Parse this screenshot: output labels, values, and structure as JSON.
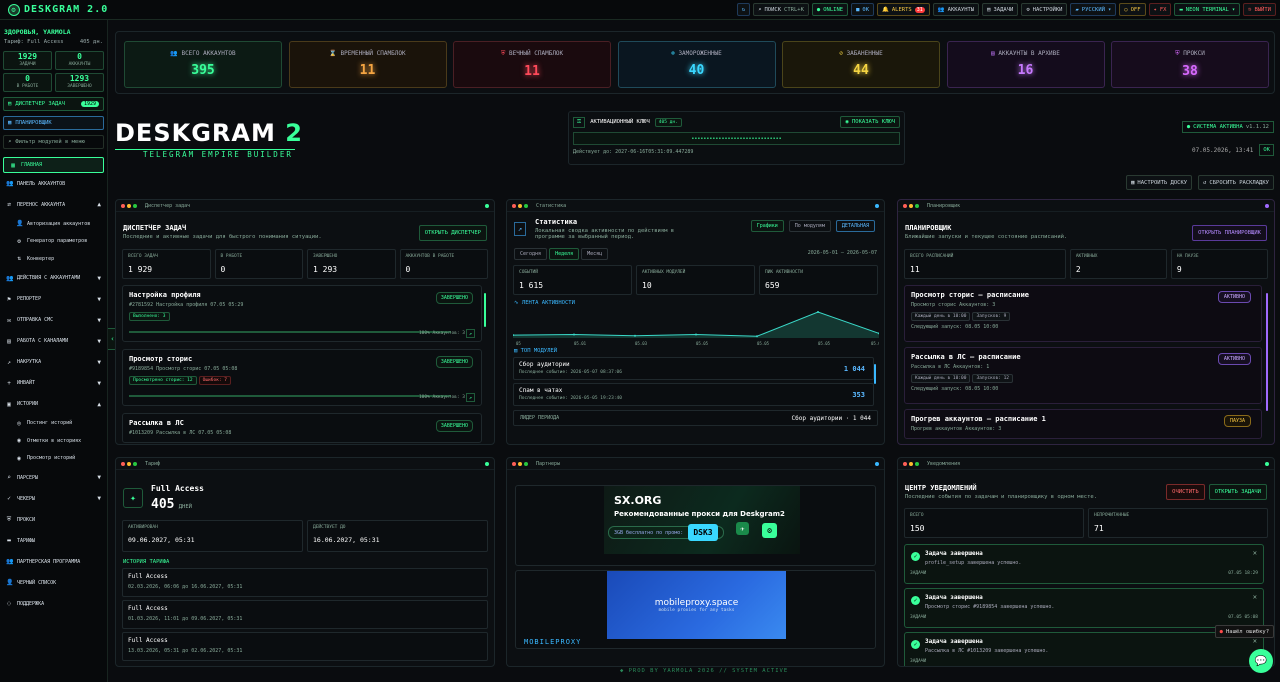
{
  "brand": {
    "name": "DESKGRAM 2.0",
    "logo_glyph": "⚙"
  },
  "topbar": {
    "refresh_icon": "↻",
    "search_label": "ПОИСК",
    "search_hint": "CTRL+K",
    "online": "ONLINE",
    "bell": "0K",
    "alerts_label": "ALERTS",
    "alerts_count": "31",
    "accounts": "АККАУНТЫ",
    "tasks": "ЗАДАЧИ",
    "settings": "НАСТРОЙКИ",
    "lang": "РУССКИЙ",
    "off": "OFF",
    "fx": "FX",
    "terminal": "NEON TERMINAL",
    "logout": "ВЫЙТИ"
  },
  "sidebar": {
    "greeting": "ЗДОРОВЬЯ, YARMOLA",
    "tariff_label": "Тариф: Full Access",
    "tariff_days": "405 дн.",
    "stats": [
      {
        "value": "1929",
        "label": "ЗАДАЧИ"
      },
      {
        "value": "0",
        "label": "АККАУНТЫ"
      },
      {
        "value": "0",
        "label": "В РАБОТЕ"
      },
      {
        "value": "1293",
        "label": "ЗАВЕРШЕНО"
      }
    ],
    "dispatcher_btn": "ДИСПЕТЧЕР ЗАДАЧ",
    "dispatcher_pill": "1929",
    "scheduler_btn": "ПЛАНИРОВЩИК",
    "filter_placeholder": "Фильтр модулей в меню",
    "nav": [
      {
        "label": "ГЛАВНАЯ",
        "icon": "▦",
        "active": true
      },
      {
        "label": "ПАНЕЛЬ АККАУНТОВ",
        "icon": "👥"
      },
      {
        "label": "ПЕРЕНОС АККАУНТА",
        "icon": "⇄",
        "caret": "▲"
      },
      {
        "label": "Авторизация аккаунтов",
        "icon": "👤",
        "sub": true
      },
      {
        "label": "Генератор параметров",
        "icon": "⚙",
        "sub": true
      },
      {
        "label": "Конвертер",
        "icon": "⇅",
        "sub": true
      },
      {
        "label": "ДЕЙСТВИЯ С АККАУНТАМИ",
        "icon": "👥",
        "caret": "▼"
      },
      {
        "label": "РЕПОРТЕР",
        "icon": "⚑",
        "caret": "▼"
      },
      {
        "label": "ОТПРАВКА СМС",
        "icon": "✉",
        "caret": "▼"
      },
      {
        "label": "РАБОТА С КАНАЛАМИ",
        "icon": "▤",
        "caret": "▼"
      },
      {
        "label": "НАКРУТКА",
        "icon": "↗",
        "caret": "▼"
      },
      {
        "label": "ИНВАЙТ",
        "icon": "+",
        "caret": "▼"
      },
      {
        "label": "ИСТОРИИ",
        "icon": "▣",
        "caret": "▲"
      },
      {
        "label": "Постинг историй",
        "icon": "◎",
        "sub": true
      },
      {
        "label": "Отметки в историях",
        "icon": "◉",
        "sub": true
      },
      {
        "label": "Просмотр историй",
        "icon": "◉",
        "sub": true
      },
      {
        "label": "ПАРСЕРЫ",
        "icon": "⌕",
        "caret": "▼"
      },
      {
        "label": "ЧЕКЕРЫ",
        "icon": "✓",
        "caret": "▼"
      },
      {
        "label": "ПРОКСИ",
        "icon": "⛨"
      },
      {
        "label": "ТАРИФЫ",
        "icon": "▬"
      },
      {
        "label": "ПАРТНЕРСКАЯ ПРОГРАММА",
        "icon": "👥"
      },
      {
        "label": "ЧЕРНЫЙ СПИСОК",
        "icon": "👤"
      },
      {
        "label": "ПОДДЕРЖКА",
        "icon": "◌"
      }
    ]
  },
  "kpis": [
    {
      "label": "ВСЕГО АККАУНТОВ",
      "value": "395",
      "icon": "👥",
      "color": "#39ff9a",
      "bg": "#0c1a14",
      "border": "#1f4a34"
    },
    {
      "label": "ВРЕМЕННЫЙ СПАМБЛОК",
      "value": "11",
      "icon": "⌛",
      "color": "#f5a542",
      "bg": "#1a130a",
      "border": "#4a3a1a"
    },
    {
      "label": "ВЕЧНЫЙ СПАМБЛОК",
      "value": "11",
      "icon": "⛨",
      "color": "#ff4a5a",
      "bg": "#1a0a0e",
      "border": "#4a1f24"
    },
    {
      "label": "ЗАМОРОЖЕННЫЕ",
      "value": "40",
      "icon": "❄",
      "color": "#3ad8ff",
      "bg": "#0a1620",
      "border": "#1f4a5a"
    },
    {
      "label": "ЗАБАНЕННЫЕ",
      "value": "44",
      "icon": "⊘",
      "color": "#f5d542",
      "bg": "#1a170a",
      "border": "#4a441a"
    },
    {
      "label": "АККАУНТЫ В АРХИВЕ",
      "value": "16",
      "icon": "▤",
      "color": "#c77aff",
      "bg": "#140c1c",
      "border": "#3a2450"
    },
    {
      "label": "ПРОКСИ",
      "value": "38",
      "icon": "⛨",
      "color": "#d86aff",
      "bg": "#160c1c",
      "border": "#3a2450"
    }
  ],
  "hero": {
    "title_a": "DESKGRAM",
    "title_b": "2",
    "tagline": "TELEGRAM EMPIRE BUILDER"
  },
  "activation": {
    "label": "АКТИВАЦИОННЫЙ КЛЮЧ",
    "days": "405 дн.",
    "show_btn": "ПОКАЗАТЬ КЛЮЧ",
    "key_masked": "••••••••••••••••••••••••••••••",
    "valid": "Действует до: 2027-06-16T05:31:09.447289"
  },
  "system": {
    "status": "СИСТЕМА АКТИВНА",
    "version": "v1.1.12",
    "datetime": "07.05.2026, 13:41",
    "ok": "OK"
  },
  "tools": {
    "configure": "НАСТРОИТЬ ДОСКУ",
    "reset": "СБРОСИТЬ РАСКЛАДКУ"
  },
  "dispatcher": {
    "header": "Диспетчер задач",
    "title": "ДИСПЕТЧЕР ЗАДАЧ",
    "subtitle": "Последние и активные задачи для быстрого понимания ситуации.",
    "open_btn": "ОТКРЫТЬ ДИСПЕТЧЕР",
    "stats": [
      {
        "label": "ВСЕГО ЗАДАЧ",
        "value": "1 929"
      },
      {
        "label": "В РАБОТЕ",
        "value": "0"
      },
      {
        "label": "ЗАВЕРШЕНО",
        "value": "1 293"
      },
      {
        "label": "АККАУНТОВ В РАБОТЕ",
        "value": "0"
      }
    ],
    "tasks": [
      {
        "title": "Настройка профиля",
        "meta": "#2781592  Настройка профиля  07.05 05:29",
        "status": "ЗАВЕРШЕНО",
        "chips": [
          "Выполнено: 3"
        ],
        "bad_chips": [],
        "progress": "100%  Аккаунтов: 3"
      },
      {
        "title": "Просмотр сторис",
        "meta": "#9189854  Просмотр сторис  07.05 05:08",
        "status": "ЗАВЕРШЕНО",
        "chips": [
          "Просмотрено сторис: 12"
        ],
        "bad_chips": [
          "Ошибок: 7"
        ],
        "progress": "100%  Аккаунтов: 3"
      },
      {
        "title": "Рассылка в ЛС",
        "meta": "#1013209  Рассылка в ЛС  07.05 05:08",
        "status": "ЗАВЕРШЕНО"
      }
    ]
  },
  "statistics": {
    "header": "Статистика",
    "title": "Статистика",
    "subtitle": "Локальная сводка активности по действиям в программе за выбранный период.",
    "view_tabs": [
      "Графики",
      "По модулям"
    ],
    "detail_btn": "ДЕТАЛЬНАЯ",
    "periods": [
      "Сегодня",
      "Неделя",
      "Месяц"
    ],
    "range": "2026-05-01 — 2026-05-07",
    "stats": [
      {
        "label": "СОБЫТИЙ",
        "value": "1 615"
      },
      {
        "label": "АКТИВНЫХ МОДУЛЕЙ",
        "value": "10"
      },
      {
        "label": "ПИК АКТИВНОСТИ",
        "value": "659"
      }
    ],
    "ribbon_label": "ЛЕНТА АКТИВНОСТИ",
    "top_label": "ТОП МОДУЛЕЙ",
    "modules": [
      {
        "name": "Сбор аудитории",
        "last": "Последнее событие: 2026-05-07 08:37:06",
        "count": "1 044"
      },
      {
        "name": "Спам в чатах",
        "last": "Последнее событие: 2026-05-05 19:23:40",
        "count": "353"
      }
    ],
    "leader_label": "ЛИДЕР ПЕРИОДА",
    "leader_value": "Сбор аудитории · 1 044"
  },
  "chart_data": {
    "type": "area",
    "x": [
      "05",
      "05.01",
      "05.03",
      "05.05",
      "05.05",
      "05.05",
      "05.07"
    ],
    "values": [
      10,
      12,
      8,
      12,
      6,
      90,
      16
    ],
    "xlabel": "",
    "ylabel": "",
    "grid": false
  },
  "scheduler": {
    "header": "Планировщик",
    "title": "ПЛАНИРОВЩИК",
    "subtitle": "Ближайшие запуски и текущее состояние расписаний.",
    "open_btn": "ОТКРЫТЬ ПЛАНИРОВЩИК",
    "stats": [
      {
        "label": "ВСЕГО РАСПИСАНИЙ",
        "value": "11"
      },
      {
        "label": "АКТИВНЫХ",
        "value": "2"
      },
      {
        "label": "НА ПАУЗЕ",
        "value": "9"
      }
    ],
    "items": [
      {
        "title": "Просмотр сторис — расписание",
        "meta": "Просмотр сторис  Аккаунтов: 3",
        "status": "АКТИВНО",
        "chips": [
          "Каждый день в 10:00",
          "Запусков: 9"
        ],
        "next": "Следующий запуск: 08.05 10:00"
      },
      {
        "title": "Рассылка в ЛС — расписание",
        "meta": "Рассылка в ЛС  Аккаунтов: 1",
        "status": "АКТИВНО",
        "chips": [
          "Каждый день в 10:00",
          "Запусков: 12"
        ],
        "next": "Следующий запуск: 08.05 10:00"
      },
      {
        "title": "Прогрев аккаунтов — расписание 1",
        "meta": "Прогрев аккаунтов  Аккаунтов: 3",
        "status": "ПАУЗА",
        "chips": [],
        "next": ""
      }
    ]
  },
  "tariff": {
    "header": "Тариф",
    "name": "Full Access",
    "days": "405",
    "days_unit": "ДНЕЙ",
    "activated_label": "АКТИВИРОВАН",
    "activated": "09.06.2027, 05:31",
    "valid_label": "ДЕЙСТВУЕТ ДО",
    "valid": "16.06.2027, 05:31",
    "history_label": "ИСТОРИЯ ТАРИФА",
    "history": [
      {
        "name": "Full Access",
        "range": "02.03.2026, 06:06 до 16.06.2027, 05:31"
      },
      {
        "name": "Full Access",
        "range": "01.03.2026, 11:01 до 09.06.2027, 05:31"
      },
      {
        "name": "Full Access",
        "range": "13.03.2026, 05:31 до 02.06.2027, 05:31"
      }
    ]
  },
  "partners": {
    "header": "Партнеры",
    "banner1_brand": "SX.ORG",
    "banner1_title": "Рекомендованные прокси для Deskgram2",
    "banner1_sub": "3GB бесплатно по промо:",
    "banner1_promo": "DSK3",
    "banner2_brand": "mobileproxy.space",
    "banner2_sub": "mobile proxies for any tasks",
    "label2": "MOBILEPROXY"
  },
  "notifications": {
    "header": "Уведомления",
    "title": "ЦЕНТР УВЕДОМЛЕНИЙ",
    "subtitle": "Последние события по задачам и планировщику в одном месте.",
    "clear_btn": "ОЧИСТИТЬ",
    "open_btn": "ОТКРЫТЬ ЗАДАЧИ",
    "stats": [
      {
        "label": "ВСЕГО",
        "value": "150"
      },
      {
        "label": "НЕПРОЧИТАННЫЕ",
        "value": "71"
      }
    ],
    "items": [
      {
        "title": "Задача завершена",
        "body": "profile_setup завершена успешно.",
        "tag": "ЗАДАЧИ",
        "time": "07.05 18:29"
      },
      {
        "title": "Задача завершена",
        "body": "Просмотр сторис #9189854 завершена успешно.",
        "tag": "ЗАДАЧИ",
        "time": "07.05 05:08"
      },
      {
        "title": "Задача завершена",
        "body": "Рассылка в ЛС #1013209 завершена успешно.",
        "tag": "ЗАДАЧИ",
        "time": ""
      }
    ]
  },
  "footer": "PROD BY YARMOLA 2026  // SYSTEM ACTIVE",
  "toast": "Нашёл ошибку?"
}
